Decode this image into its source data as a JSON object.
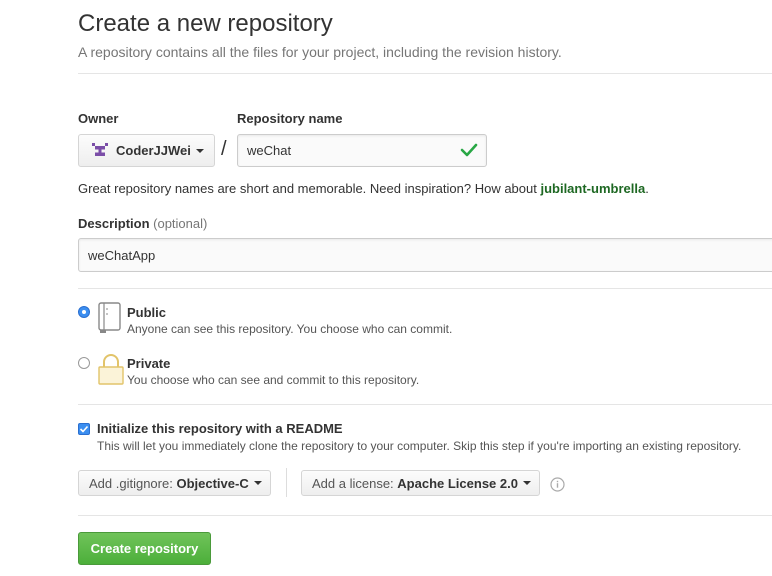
{
  "header": {
    "title": "Create a new repository",
    "subtitle": "A repository contains all the files for your project, including the revision history."
  },
  "owner": {
    "label": "Owner",
    "value": "CoderJJWei"
  },
  "separator": "/",
  "repo": {
    "label": "Repository name",
    "value": "weChat"
  },
  "hint": {
    "text": "Great repository names are short and memorable. Need inspiration? How about ",
    "suggestion": "jubilant-umbrella",
    "end": "."
  },
  "description": {
    "label": "Description",
    "optional": "(optional)",
    "value": "weChatApp"
  },
  "visibility": {
    "public": {
      "title": "Public",
      "desc": "Anyone can see this repository. You choose who can commit.",
      "selected": true
    },
    "private": {
      "title": "Private",
      "desc": "You choose who can see and commit to this repository.",
      "selected": false
    }
  },
  "readme": {
    "label": "Initialize this repository with a README",
    "desc": "This will let you immediately clone the repository to your computer. Skip this step if you're importing an existing repository.",
    "checked": true
  },
  "gitignore": {
    "prefix": "Add .gitignore:",
    "value": "Objective-C"
  },
  "license": {
    "prefix": "Add a license:",
    "value": "Apache License 2.0"
  },
  "submit": {
    "label": "Create repository"
  },
  "icons": {
    "avatar": "identicon-avatar",
    "valid": "check-icon",
    "public": "repo-book-icon",
    "private": "lock-icon",
    "info": "info-icon"
  },
  "colors": {
    "accent": "#28a745",
    "suggestion": "#1e6823",
    "radio": "#3b8ef0"
  }
}
